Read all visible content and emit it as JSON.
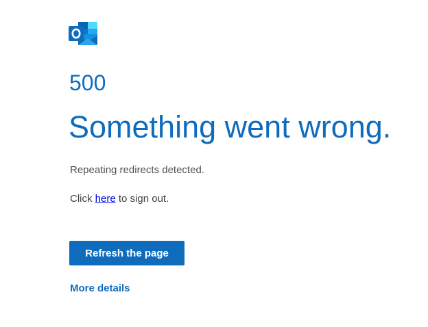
{
  "app": {
    "logo_icon": "outlook-logo-icon",
    "brand_color": "#0f6cbd"
  },
  "error": {
    "code": "500",
    "title": "Something went wrong.",
    "message": "Repeating redirects detected."
  },
  "signout": {
    "prefix": "Click ",
    "link_text": "here",
    "suffix": " to sign out."
  },
  "actions": {
    "refresh_label": "Refresh the page",
    "more_details_label": "More details"
  }
}
